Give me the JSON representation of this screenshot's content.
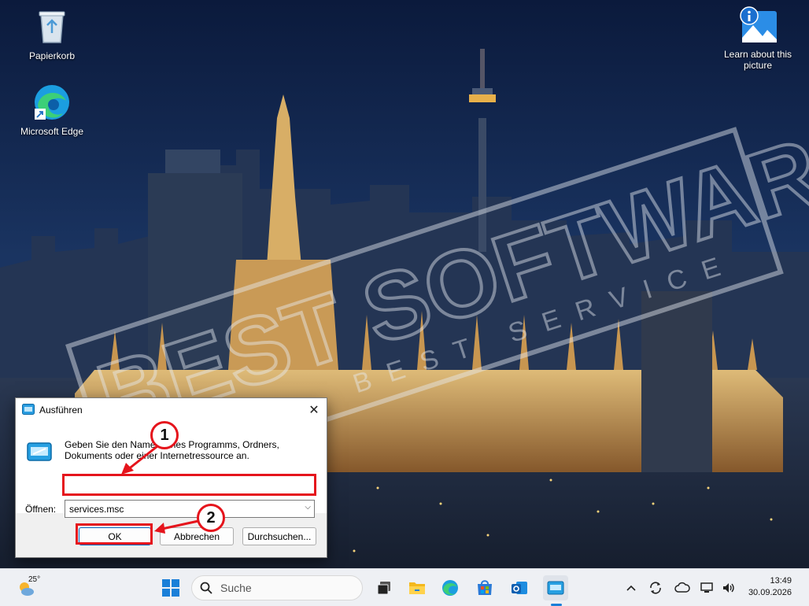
{
  "desktop": {
    "icons": [
      {
        "label": "Papierkorb",
        "icon": "recycle-bin-icon"
      },
      {
        "label": "Microsoft Edge",
        "icon": "edge-icon"
      },
      {
        "label": "Learn about this picture",
        "icon": "info-picture-icon"
      }
    ]
  },
  "watermark": {
    "brand": "BEST SOFTWARE",
    "tagline": "BEST SERVICE"
  },
  "run_dialog": {
    "title": "Ausführen",
    "description": "Geben Sie den Namen eines Programms, Ordners, Dokuments oder einer Internetressource an.",
    "open_label": "Öffnen:",
    "input_value": "services.msc",
    "ok_label": "OK",
    "cancel_label": "Abbrechen",
    "browse_label": "Durchsuchen...",
    "callouts": [
      "1",
      "2"
    ],
    "highlight_color": "#e5141c"
  },
  "taskbar": {
    "weather": {
      "temp": "25°",
      "icon": "sun-cloud-icon"
    },
    "search_placeholder": "Suche",
    "apps": [
      "start-icon",
      "task-view-icon",
      "file-explorer-icon",
      "edge-icon",
      "store-icon",
      "outlook-icon",
      "run-icon"
    ],
    "tray": [
      "chevron-up-icon",
      "sync-icon",
      "cloud-icon",
      "network-icon",
      "volume-icon"
    ],
    "time": "13:49",
    "date": "30.09.2026"
  }
}
